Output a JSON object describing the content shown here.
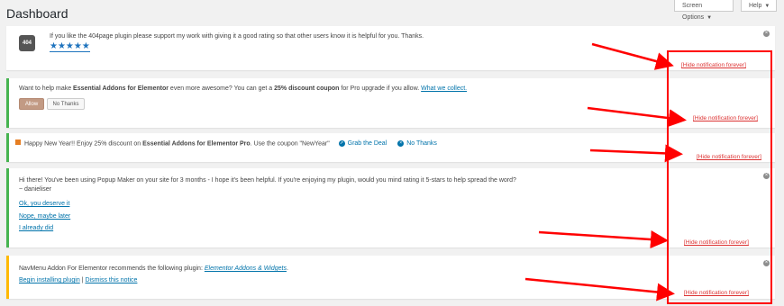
{
  "header": {
    "title": "Dashboard",
    "screen_options_label": "Screen Options",
    "help_label": "Help"
  },
  "notices": {
    "n404": {
      "logo_text": "404",
      "message": "If you like the 404page plugin please support my work with giving it a good rating so that other users know it is helpful for you. Thanks.",
      "stars": "★★★★★",
      "hide_label": "[Hide notification forever]"
    },
    "essential_addons": {
      "message_start": "Want to help make ",
      "brand": "Essential Addons for Elementor",
      "message_mid": " even more awesome? You can get a ",
      "discount": "25% discount coupon",
      "message_end": " for Pro upgrade if you allow. ",
      "what_we_collect": "What we collect.",
      "allow_label": "Allow",
      "no_thanks_label": "No Thanks",
      "hide_label": "[Hide notification forever]"
    },
    "new_year": {
      "message_start": "Happy New Year!! Enjoy 25% discount on ",
      "brand": "Essential Addons for Elementor Pro",
      "message_end": ". Use the coupon \"NewYear\"",
      "grab_label": "Grab the Deal",
      "no_thanks_label": "No Thanks",
      "hide_label": "[Hide notification forever]"
    },
    "popup_maker": {
      "message": "Hi there! You've been using Popup Maker on your site for 3 months - I hope it's been helpful. If you're enjoying my plugin, would you mind rating it 5-stars to help spread the word?",
      "signature": "~ danieliser",
      "link1": "Ok, you deserve it",
      "link2": "Nope, maybe later",
      "link3": "I already did",
      "hide_label": "[Hide notification forever]"
    },
    "navmenu": {
      "message": "NavMenu Addon For Elementor recommends the following plugin: ",
      "plugin_link": "Elementor Addons & Widgets",
      "period": ".",
      "begin_label": "Begin installing plugin",
      "separator": "|",
      "dismiss_label": "Dismiss this notice",
      "hide_label": "[Hide notification forever]"
    }
  },
  "colors": {
    "annotation_red": "#ff0000",
    "hide_link_red": "#dc3232",
    "link_blue": "#0073aa",
    "green_border": "#46b450",
    "yellow_border": "#ffb900"
  }
}
